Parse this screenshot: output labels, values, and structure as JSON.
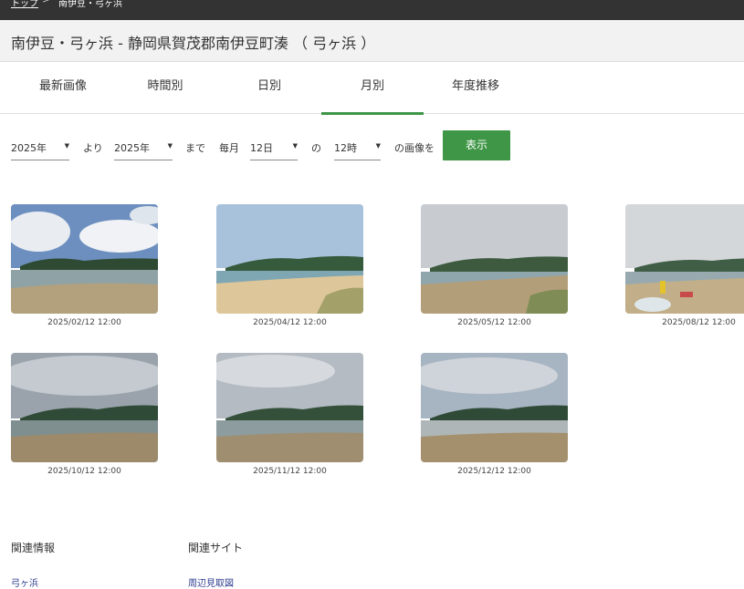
{
  "breadcrumb": {
    "home": "トップ",
    "separator": ">",
    "current": "南伊豆・弓ヶ浜"
  },
  "page_title": "南伊豆・弓ヶ浜 - 静岡県賀茂郡南伊豆町湊 （ 弓ヶ浜 ）",
  "tabs": [
    {
      "label": "最新画像",
      "active": false
    },
    {
      "label": "時間別",
      "active": false
    },
    {
      "label": "日別",
      "active": false
    },
    {
      "label": "月別",
      "active": true
    },
    {
      "label": "年度推移",
      "active": false
    }
  ],
  "filter": {
    "from_year": "2025年",
    "from_label": "より",
    "to_year": "2025年",
    "to_label": "まで",
    "every_month_label": "毎月",
    "day": "12日",
    "of_label": "の",
    "hour": "12時",
    "suffix_label": "の画像を",
    "submit_label": "表示"
  },
  "images": [
    {
      "caption": "2025/02/12 12:00"
    },
    {
      "caption": "2025/04/12 12:00"
    },
    {
      "caption": "2025/05/12 12:00"
    },
    {
      "caption": "2025/08/12 12:00"
    },
    {
      "caption": "2025/10/12 12:00"
    },
    {
      "caption": "2025/11/12 12:00"
    },
    {
      "caption": "2025/12/12 12:00"
    }
  ],
  "footer": {
    "related_info_heading": "関連情報",
    "related_sites_heading": "関連サイト",
    "related_info_link": "弓ヶ浜",
    "related_sites_link": "周辺見取図"
  },
  "colors": {
    "accent": "#3e9646",
    "topbar": "#333333",
    "link": "#2a3a8c"
  }
}
